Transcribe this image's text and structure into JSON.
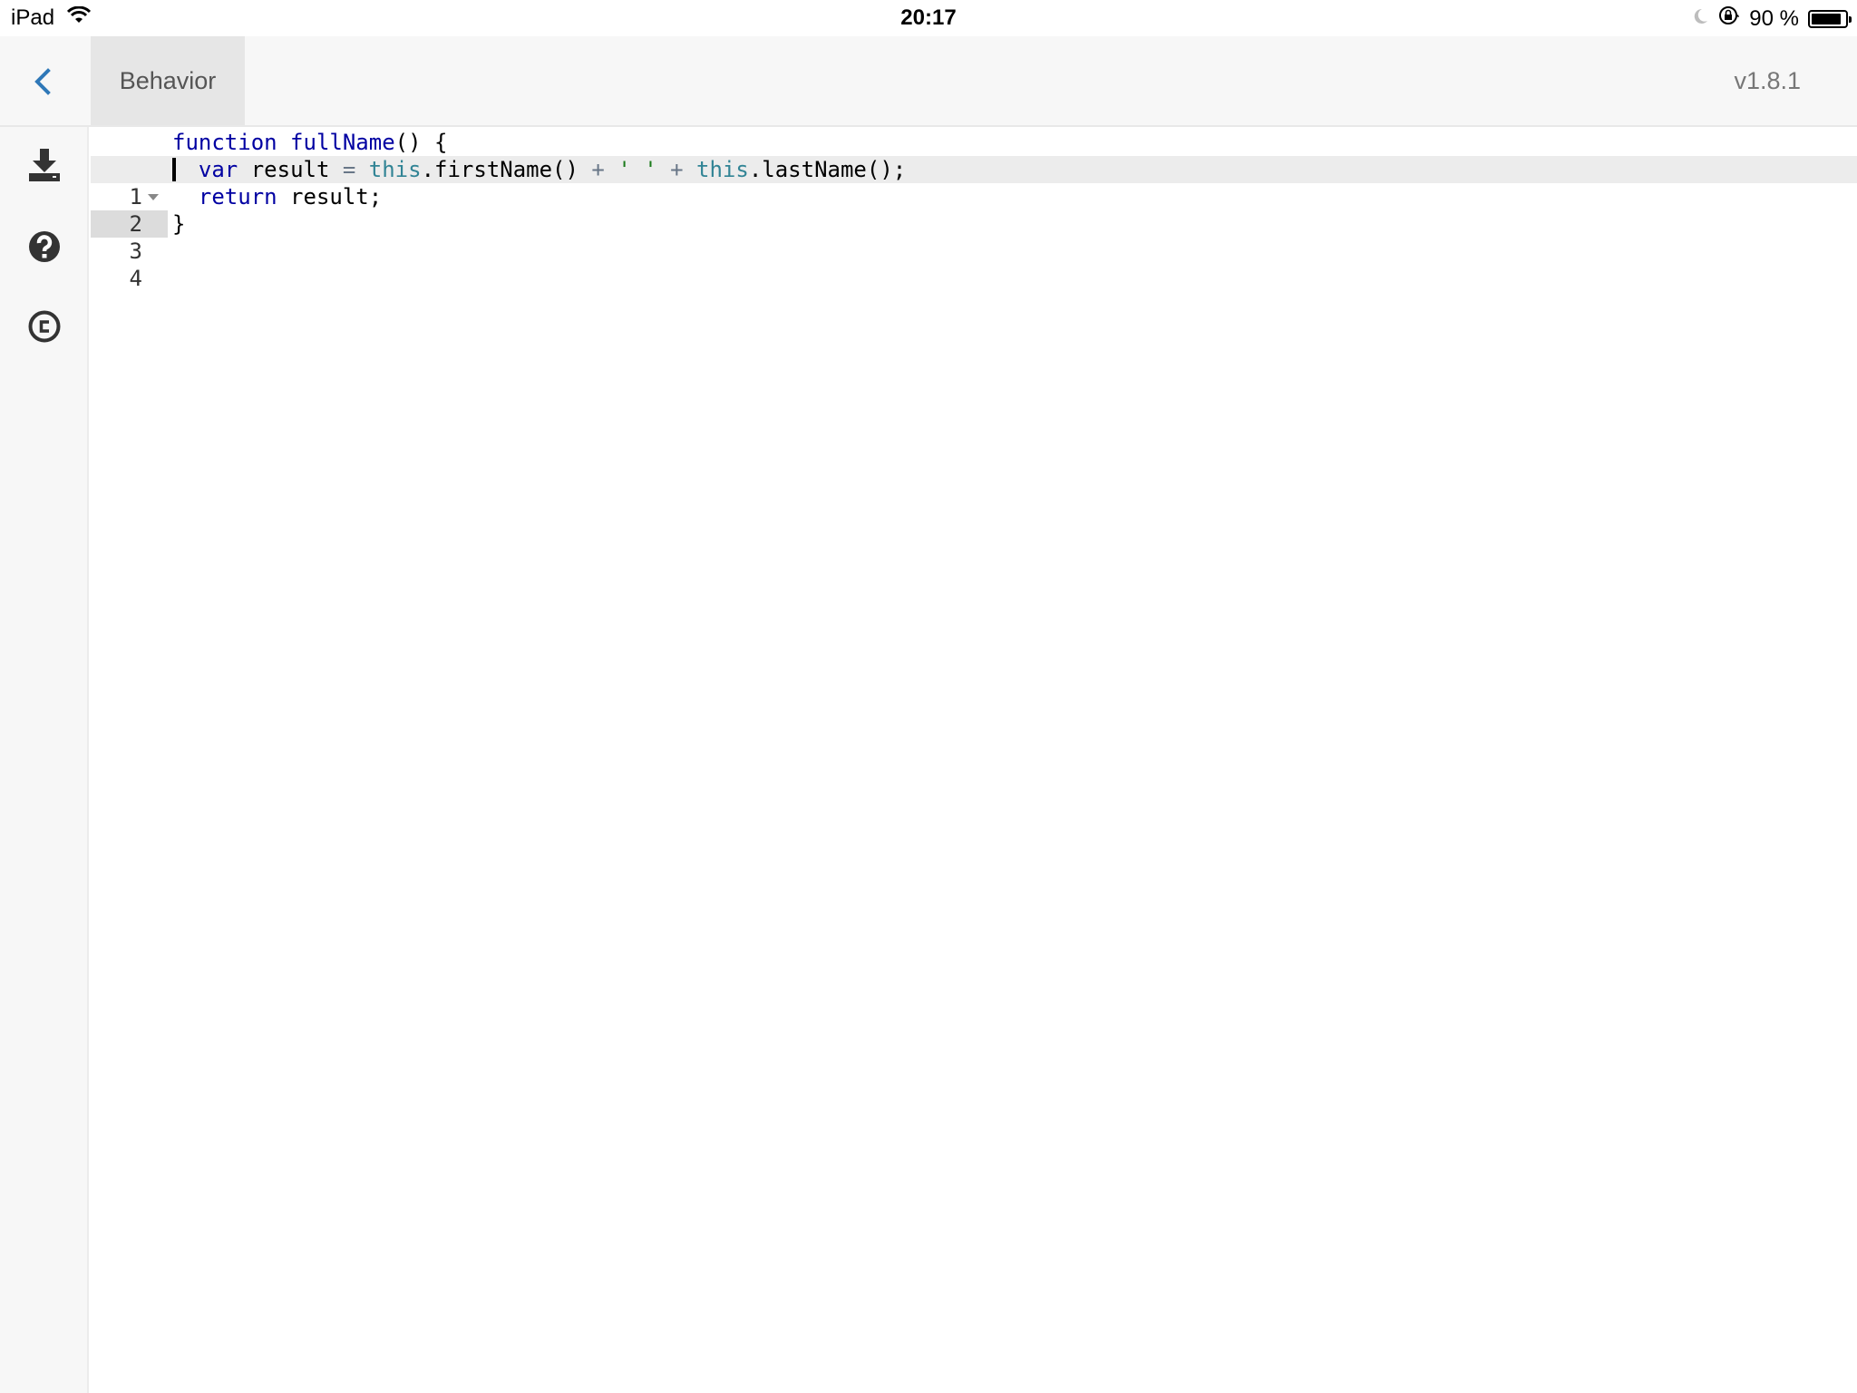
{
  "status_bar": {
    "device": "iPad",
    "time": "20:17",
    "battery_percent": "90 %",
    "battery_level": 0.9,
    "icons": [
      "wifi-icon",
      "moon-icon",
      "rotation-lock-icon",
      "battery-icon"
    ]
  },
  "header": {
    "back_icon": "chevron-left-icon",
    "active_tab": "Behavior",
    "version": "v1.8.1",
    "accent_color": "#2f78b8"
  },
  "sidebar": {
    "items": [
      {
        "name": "download",
        "icon": "download-icon"
      },
      {
        "name": "help",
        "icon": "help-icon"
      },
      {
        "name": "copyright",
        "icon": "copyright-icon"
      }
    ]
  },
  "editor": {
    "active_line": 2,
    "lines": [
      {
        "number": "1",
        "foldable": true,
        "tokens": [
          [
            "kw",
            "function"
          ],
          [
            "plain",
            " "
          ],
          [
            "fn",
            "fullName"
          ],
          [
            "plain",
            "() {"
          ]
        ]
      },
      {
        "number": "2",
        "foldable": false,
        "tokens": [
          [
            "plain",
            "  "
          ],
          [
            "kw",
            "var"
          ],
          [
            "plain",
            " result "
          ],
          [
            "op",
            "="
          ],
          [
            "plain",
            " "
          ],
          [
            "this",
            "this"
          ],
          [
            "plain",
            ".firstName() "
          ],
          [
            "op",
            "+"
          ],
          [
            "plain",
            " "
          ],
          [
            "str",
            "' '"
          ],
          [
            "plain",
            " "
          ],
          [
            "op",
            "+"
          ],
          [
            "plain",
            " "
          ],
          [
            "this",
            "this"
          ],
          [
            "plain",
            ".lastName();"
          ]
        ]
      },
      {
        "number": "3",
        "foldable": false,
        "tokens": [
          [
            "plain",
            "  "
          ],
          [
            "kw",
            "return"
          ],
          [
            "plain",
            " result;"
          ]
        ]
      },
      {
        "number": "4",
        "foldable": false,
        "tokens": [
          [
            "plain",
            "}"
          ]
        ]
      }
    ]
  }
}
